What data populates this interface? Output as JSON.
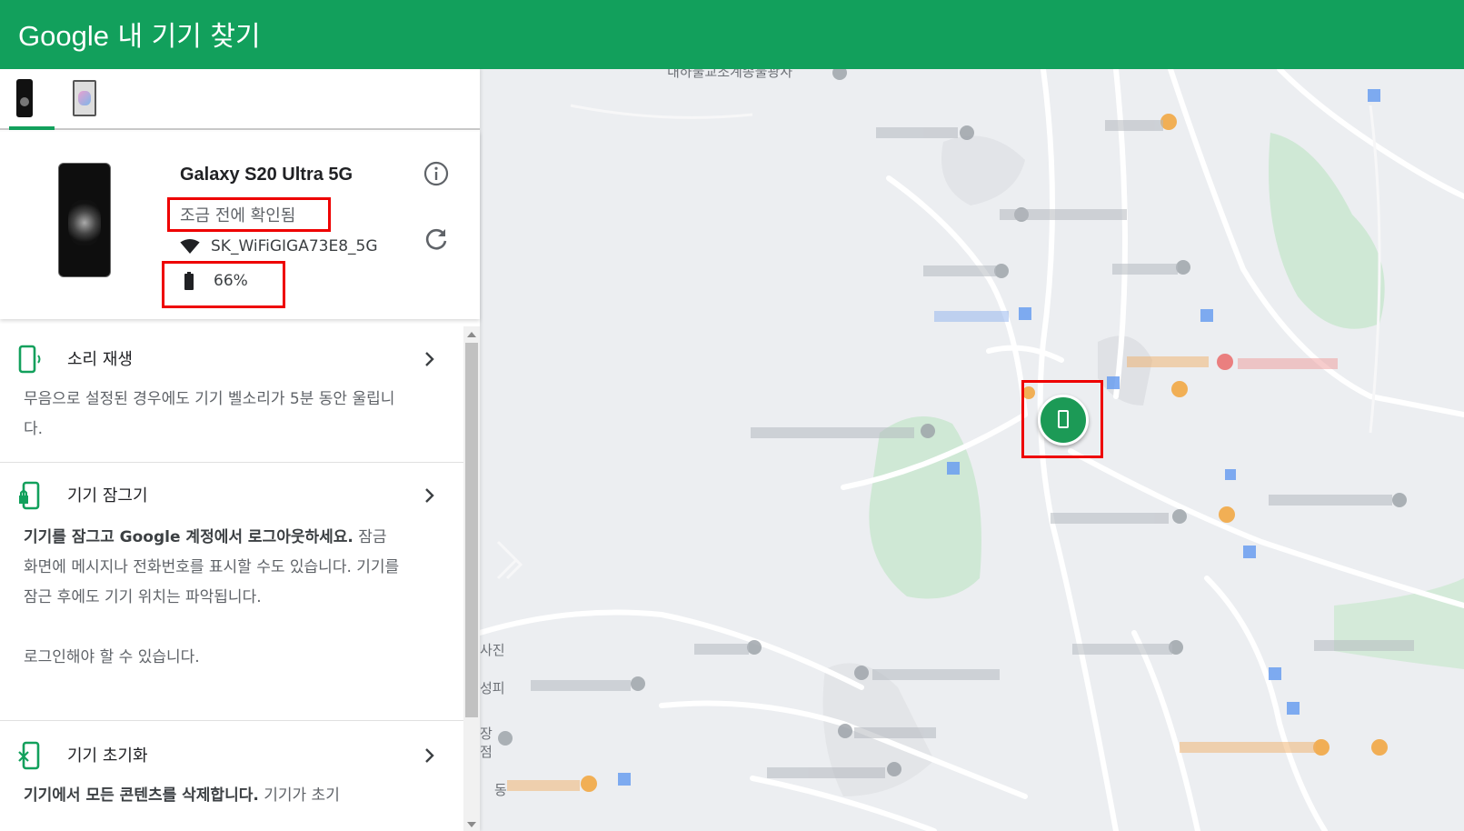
{
  "header": {
    "brand": "Google",
    "title": "내 기기 찾기",
    "bg_color": "#12a05c"
  },
  "device_tabs": [
    {
      "label": "Galaxy S20 Ultra 5G thumbnail",
      "selected": true
    },
    {
      "label": "Tablet thumbnail",
      "selected": false
    }
  ],
  "device": {
    "name": "Galaxy S20 Ultra 5G",
    "last_seen": "조금 전에 확인됨",
    "wifi": "SK_WiFiGIGA73E8_5G",
    "battery": "66%",
    "info_icon": "info-icon",
    "refresh_icon": "refresh-icon"
  },
  "actions": [
    {
      "title": "소리 재생",
      "icon": "phone-ring-icon",
      "desc": "무음으로 설정된 경우에도 기기 벨소리가 5분 동안 울립니다."
    },
    {
      "title": "기기 잠그기",
      "icon": "phone-lock-icon",
      "desc_bold": "기기를 잠그고 Google 계정에서 로그아웃하세요.",
      "desc": "잠금 화면에 메시지나 전화번호를 표시할 수도 있습니다. 기기를 잠근 후에도 기기 위치는 파악됩니다.",
      "desc2": "로그인해야 할 수 있습니다."
    },
    {
      "title": "기기 초기화",
      "icon": "phone-erase-icon",
      "desc_bold": "기기에서 모든 콘텐츠를 삭제합니다.",
      "desc": "기기가 초기"
    }
  ],
  "map": {
    "visible_labels": {
      "top": "내하불교조계종불광사",
      "left_1": "사진",
      "left_2": "성피",
      "left_3": "장",
      "left_4": "점",
      "left_5": "동"
    },
    "marker_color": "#1c9a56",
    "highlight_color": "#e00000"
  }
}
